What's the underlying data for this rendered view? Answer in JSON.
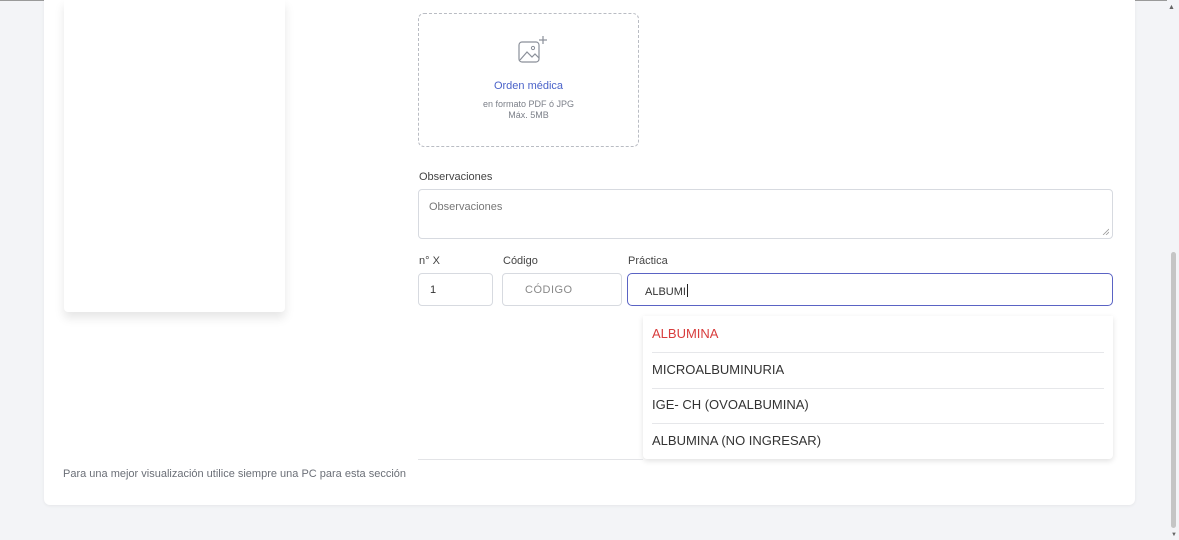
{
  "upload": {
    "title": "Orden médica",
    "format": "en formato PDF ó JPG",
    "max_size": "Máx. 5MB",
    "icon": "image-add-icon"
  },
  "observaciones": {
    "label": "Observaciones",
    "placeholder": "Observaciones"
  },
  "fields": {
    "nx_label": "n° X",
    "nx_value": "1",
    "codigo_label": "Código",
    "codigo_placeholder": "CÓDIGO",
    "practica_label": "Práctica",
    "practica_value": "ALBUMI"
  },
  "dropdown": {
    "options": [
      "ALBUMINA",
      "MICROALBUMINURIA",
      "IGE- CH (OVOALBUMINA)",
      "ALBUMINA (NO INGRESAR)"
    ],
    "highlighted_color": "#d83c3c"
  },
  "footer_note": "Para una mejor visualización utilice siempre una PC para esta sección",
  "colors": {
    "accent": "#5a63c4",
    "link": "#4b63c9",
    "background": "#f3f4f7"
  }
}
